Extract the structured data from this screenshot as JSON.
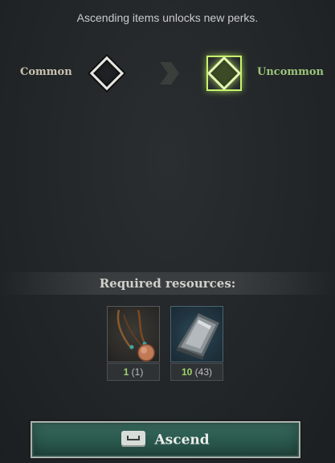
{
  "hint_text": "Ascending items unlocks new perks.",
  "tiers": {
    "from_label": "Common",
    "to_label": "Uncommon",
    "from_color": "#e7e7e2",
    "to_color": "#c8f36e"
  },
  "resources": {
    "title": "Required resources:",
    "items": [
      {
        "icon": "amulet-icon",
        "required": "1",
        "owned": "(1)"
      },
      {
        "icon": "metal-ingot-icon",
        "required": "10",
        "owned": "(43)"
      }
    ]
  },
  "ascend_button": {
    "label": "Ascend",
    "key_icon": "spacebar-key-icon"
  },
  "colors": {
    "accent_green": "#9fd36a",
    "button_bg": "#2b5a4f"
  }
}
